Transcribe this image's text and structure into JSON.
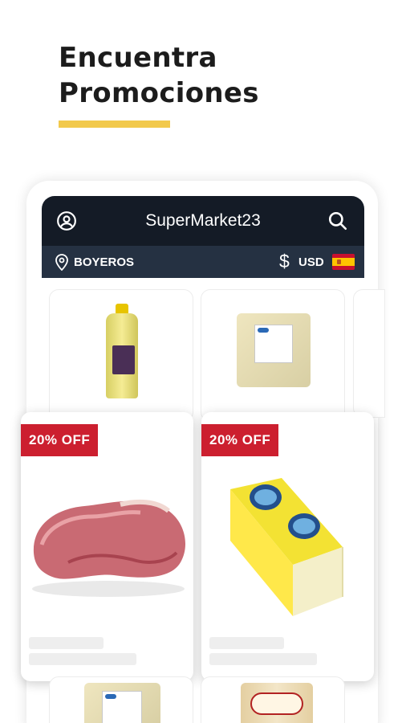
{
  "hero": {
    "line1": "Encuentra",
    "line2": "Promociones"
  },
  "header": {
    "title": "SuperMarket23",
    "location": "BOYEROS",
    "currency_symbol": "$",
    "currency": "USD",
    "icons": {
      "user": "user-circle-icon",
      "search": "search-icon",
      "location": "map-pin-icon",
      "flag": "spain-flag-icon"
    }
  },
  "products": {
    "top": [
      {
        "image": "cooking-oil-bottle"
      },
      {
        "image": "rice-bag"
      }
    ],
    "featured": [
      {
        "badge": "20% OFF",
        "image": "raw-pork-meat"
      },
      {
        "badge": "20% OFF",
        "image": "gouda-cheese-block"
      }
    ],
    "bottom": [
      {
        "image": "rice-bag"
      },
      {
        "image": "fideos-pasta-bag"
      }
    ]
  },
  "colors": {
    "accent": "#f2c94c",
    "header_dark": "#141b26",
    "header_sub": "#253142",
    "promo_red": "#cc1f2f"
  }
}
